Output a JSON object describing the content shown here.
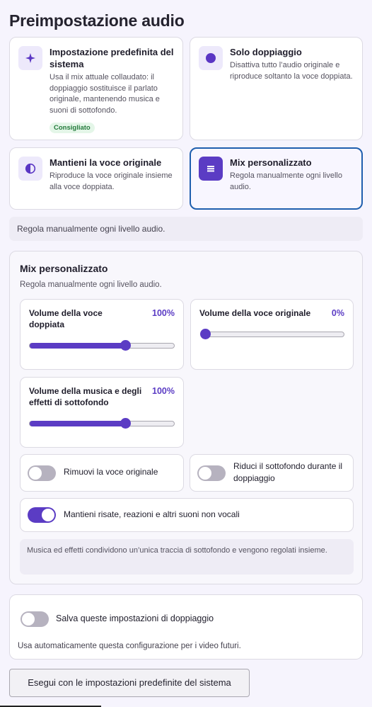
{
  "page_title": "Preimpostazione audio",
  "options": [
    {
      "icon": "sparkle-icon",
      "title": "Impostazione predefinita del sistema",
      "desc": "Usa il mix attuale collaudato: il doppiaggio sostituisce il parlato originale, mantenendo musica e suoni di sottofondo.",
      "badge": "Consigliato",
      "selected": false
    },
    {
      "icon": "dot-icon",
      "title": "Solo doppiaggio",
      "desc": "Disattiva tutto l’audio originale e riproduce soltanto la voce doppiata.",
      "selected": false
    },
    {
      "icon": "half-circle-icon",
      "title": "Mantieni la voce originale",
      "desc": "Riproduce la voce originale insieme alla voce doppiata.",
      "selected": false
    },
    {
      "icon": "menu-lines-icon",
      "title": "Mix personalizzato",
      "desc": "Regola manualmente ogni livello audio.",
      "selected": true
    }
  ],
  "selected_description": "Regola manualmente ogni livello audio.",
  "mix_panel": {
    "title": "Mix personalizzato",
    "subtitle": "Regola manualmente ogni livello audio.",
    "sliders": [
      {
        "label": "Volume della voce doppiata",
        "value_text": "100%",
        "position": 0.66
      },
      {
        "label": "Volume della voce originale",
        "value_text": "0%",
        "position": 0.0
      },
      {
        "label": "Volume della musica e degli effetti di sottofondo",
        "value_text": "100%",
        "position": 0.66
      }
    ],
    "toggles": [
      {
        "label": "Rimuovi la voce originale",
        "on": false
      },
      {
        "label": "Riduci il sottofondo durante il doppiaggio",
        "on": false
      },
      {
        "label": "Mantieni risate, reazioni e altri suoni non vocali",
        "on": true
      }
    ],
    "note": "Musica ed effetti condividono un’unica traccia di sottofondo e vengono regolati insieme."
  },
  "save": {
    "label": "Salva queste impostazioni di doppiaggio",
    "desc": "Usa automaticamente questa configurazione per i video futuri.",
    "on": false
  },
  "run_button": "Esegui con le impostazioni predefinite del sistema",
  "colors": {
    "accent": "#5b3cc4",
    "selected_border": "#1f5fae",
    "badge_green": "#237a3b"
  }
}
